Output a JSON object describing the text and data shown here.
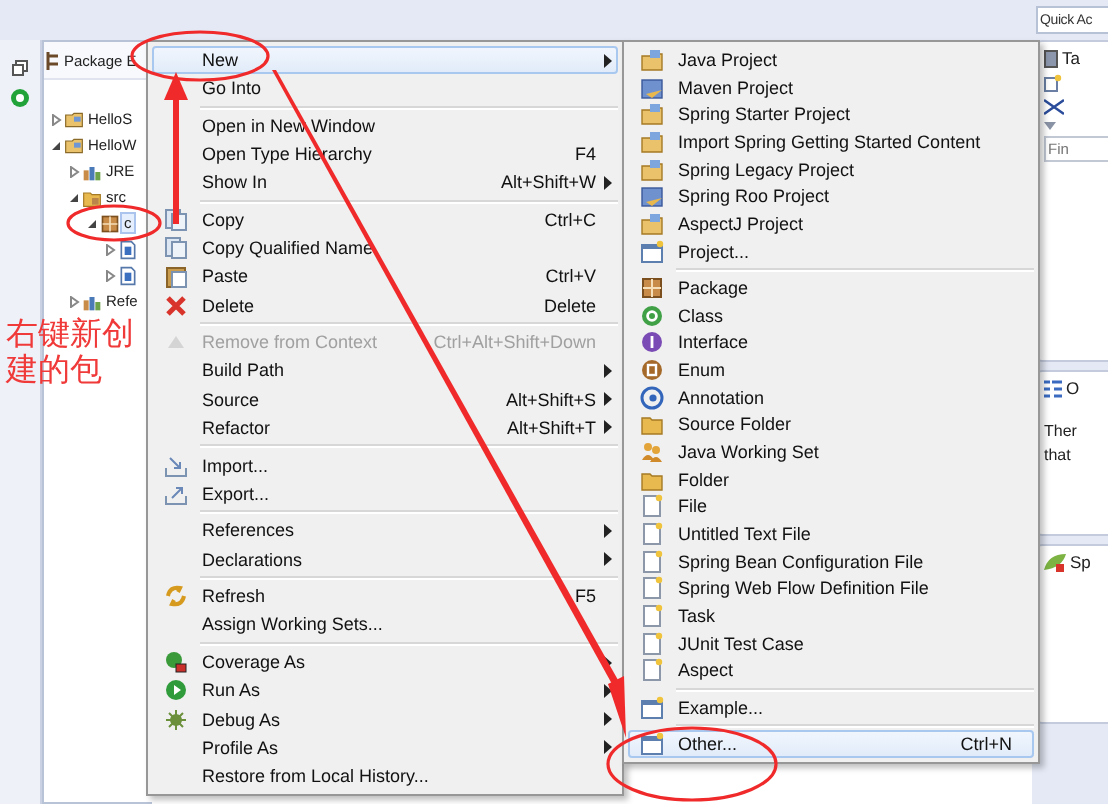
{
  "toolbar": {
    "quick_access": "Quick Ac"
  },
  "package_explorer": {
    "tab": "Package E",
    "tree": [
      {
        "label": "HelloS",
        "kind": "project",
        "expanded": false,
        "selected": false
      },
      {
        "label": "HelloW",
        "kind": "project",
        "expanded": true,
        "selected": false,
        "children": [
          {
            "label": "JRE",
            "kind": "library",
            "expanded": false,
            "selected": false
          },
          {
            "label": "src",
            "kind": "source",
            "expanded": true,
            "selected": false,
            "children": [
              {
                "label": "c",
                "kind": "package",
                "expanded": true,
                "selected": true,
                "children": [
                  {
                    "kind": "java_file",
                    "expanded": false,
                    "selected": false
                  },
                  {
                    "kind": "java_file",
                    "expanded": false,
                    "selected": false
                  }
                ]
              }
            ]
          },
          {
            "label": "Refe",
            "kind": "library",
            "expanded": false,
            "selected": false
          }
        ]
      }
    ]
  },
  "context_menu": {
    "groups": [
      [
        {
          "label": "New",
          "submenu": true,
          "selected": true,
          "disabled": false
        },
        {
          "label": "Go Into",
          "selected": false,
          "disabled": false
        }
      ],
      [
        {
          "label": "Open in New Window",
          "selected": false,
          "disabled": false
        },
        {
          "label": "Open Type Hierarchy",
          "shortcut": "F4",
          "selected": false,
          "disabled": false
        },
        {
          "label": "Show In",
          "shortcut": "Alt+Shift+W",
          "submenu": true,
          "selected": false,
          "disabled": false
        }
      ],
      [
        {
          "label": "Copy",
          "kind": "copy",
          "shortcut": "Ctrl+C",
          "selected": false,
          "disabled": false
        },
        {
          "label": "Copy Qualified Name",
          "kind": "copy",
          "selected": false,
          "disabled": false
        },
        {
          "label": "Paste",
          "kind": "paste",
          "shortcut": "Ctrl+V",
          "selected": false,
          "disabled": false
        },
        {
          "label": "Delete",
          "kind": "delete",
          "shortcut": "Delete",
          "selected": false,
          "disabled": false
        }
      ],
      [
        {
          "label": "Remove from Context",
          "kind": "remove",
          "shortcut": "Ctrl+Alt+Shift+Down",
          "selected": false,
          "disabled": true
        },
        {
          "label": "Build Path",
          "submenu": true,
          "selected": false,
          "disabled": false
        },
        {
          "label": "Source",
          "shortcut": "Alt+Shift+S",
          "submenu": true,
          "selected": false,
          "disabled": false
        },
        {
          "label": "Refactor",
          "shortcut": "Alt+Shift+T",
          "submenu": true,
          "selected": false,
          "disabled": false
        }
      ],
      [
        {
          "label": "Import...",
          "kind": "import",
          "selected": false,
          "disabled": false
        },
        {
          "label": "Export...",
          "kind": "export",
          "selected": false,
          "disabled": false
        }
      ],
      [
        {
          "label": "References",
          "submenu": true,
          "selected": false,
          "disabled": false
        },
        {
          "label": "Declarations",
          "submenu": true,
          "selected": false,
          "disabled": false
        }
      ],
      [
        {
          "label": "Refresh",
          "kind": "refresh",
          "shortcut": "F5",
          "selected": false,
          "disabled": false
        },
        {
          "label": "Assign Working Sets...",
          "selected": false,
          "disabled": false
        }
      ],
      [
        {
          "label": "Coverage As",
          "kind": "coverage",
          "submenu": true,
          "selected": false,
          "disabled": false
        },
        {
          "label": "Run As",
          "kind": "run",
          "submenu": true,
          "selected": false,
          "disabled": false
        },
        {
          "label": "Debug As",
          "kind": "debug",
          "submenu": true,
          "selected": false,
          "disabled": false
        },
        {
          "label": "Profile As",
          "submenu": true,
          "selected": false,
          "disabled": false
        },
        {
          "label": "Restore from Local History...",
          "selected": false,
          "disabled": false
        }
      ]
    ]
  },
  "new_submenu": {
    "groups": [
      [
        {
          "label": "Java Project",
          "kind": "project",
          "selected": false
        },
        {
          "label": "Maven Project",
          "kind": "maven",
          "selected": false
        },
        {
          "label": "Spring Starter Project",
          "kind": "project",
          "selected": false
        },
        {
          "label": "Import Spring Getting Started Content",
          "kind": "project",
          "selected": false
        },
        {
          "label": "Spring Legacy Project",
          "kind": "project",
          "selected": false
        },
        {
          "label": "Spring Roo Project",
          "kind": "maven",
          "selected": false
        },
        {
          "label": "AspectJ Project",
          "kind": "project",
          "selected": false
        },
        {
          "label": "Project...",
          "kind": "window",
          "selected": false
        }
      ],
      [
        {
          "label": "Package",
          "kind": "package",
          "selected": false
        },
        {
          "label": "Class",
          "kind": "class",
          "selected": false
        },
        {
          "label": "Interface",
          "kind": "interface",
          "selected": false
        },
        {
          "label": "Enum",
          "kind": "enum",
          "selected": false
        },
        {
          "label": "Annotation",
          "kind": "annotation",
          "selected": false
        },
        {
          "label": "Source Folder",
          "kind": "folder",
          "selected": false
        },
        {
          "label": "Java Working Set",
          "kind": "people",
          "selected": false
        },
        {
          "label": "Folder",
          "kind": "folder",
          "selected": false
        },
        {
          "label": "File",
          "kind": "file",
          "selected": false
        },
        {
          "label": "Untitled Text File",
          "kind": "file",
          "selected": false
        },
        {
          "label": "Spring Bean Configuration File",
          "kind": "file",
          "selected": false
        },
        {
          "label": "Spring Web Flow Definition File",
          "kind": "file",
          "selected": false
        },
        {
          "label": "Task",
          "kind": "file",
          "selected": false
        },
        {
          "label": "JUnit Test Case",
          "kind": "file",
          "selected": false
        },
        {
          "label": "Aspect",
          "kind": "file",
          "selected": false
        }
      ],
      [
        {
          "label": "Example...",
          "kind": "window",
          "selected": false
        }
      ],
      [
        {
          "label": "Other...",
          "kind": "window",
          "shortcut": "Ctrl+N",
          "selected": true
        }
      ]
    ]
  },
  "right_panel": {
    "task_tab": "Ta",
    "find_placeholder": "Fin",
    "outline_tab": "O",
    "outline_message": "Ther that",
    "spring_tab": "Sp"
  },
  "annotation": {
    "text": "右键新创建的包"
  }
}
